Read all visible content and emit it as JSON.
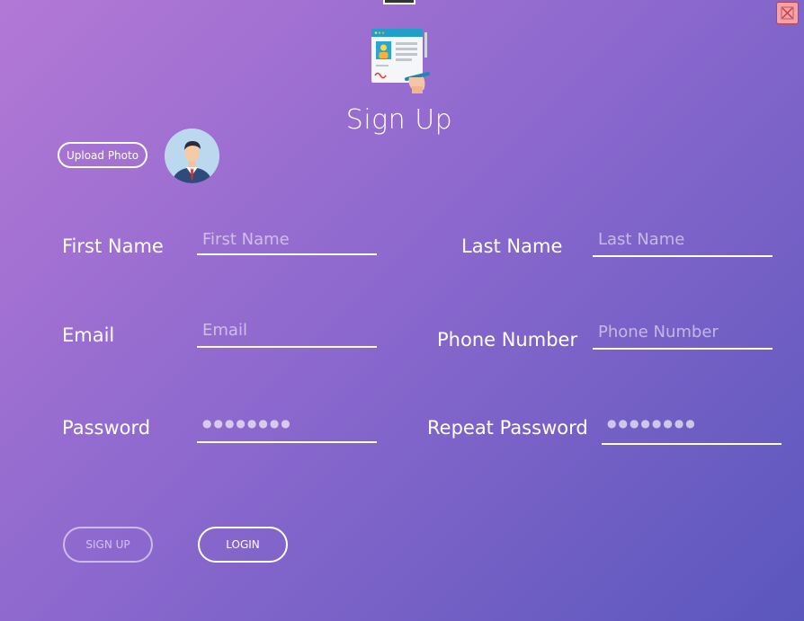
{
  "title": "Sign Up",
  "upload_photo_label": "Upload Photo",
  "icons": {
    "close": "close-icon",
    "form": "signup-form-icon",
    "avatar": "user-avatar"
  },
  "colors": {
    "gradient_start": "#b378d6",
    "gradient_end": "#5a57bd",
    "close_bg": "#f4a1a8"
  },
  "fields": {
    "first_name": {
      "label": "First Name",
      "placeholder": "First Name"
    },
    "last_name": {
      "label": "Last Name",
      "placeholder": "Last Name"
    },
    "email": {
      "label": "Email",
      "placeholder": "Email"
    },
    "phone": {
      "label": "Phone Number",
      "placeholder": "Phone Number"
    },
    "password": {
      "label": "Password",
      "value": "●●●●●●●●"
    },
    "repeat_password": {
      "label": "Repeat Password",
      "value": "●●●●●●●●"
    }
  },
  "buttons": {
    "sign_up": "SIGN UP",
    "login": "LOGIN"
  }
}
